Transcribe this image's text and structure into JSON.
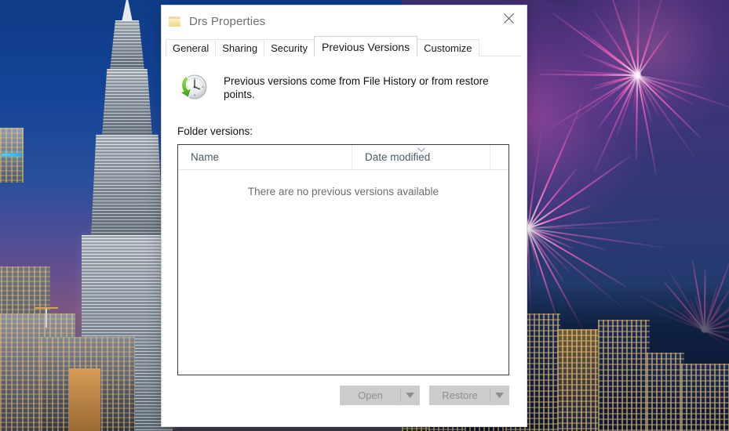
{
  "desktop": {
    "wallpaper_left": "petronas-towers-at-dusk",
    "wallpaper_right": "fireworks-over-city-skyline",
    "sky_color_left": "#154497",
    "sky_color_right": "#2b3a72",
    "firework_color": "#ff5fc0"
  },
  "dialog": {
    "title": "Drs Properties",
    "title_icon": "folder-icon",
    "close_label": "Close",
    "tabs": [
      {
        "label": "General",
        "active": false
      },
      {
        "label": "Sharing",
        "active": false
      },
      {
        "label": "Security",
        "active": false
      },
      {
        "label": "Previous Versions",
        "active": true
      },
      {
        "label": "Customize",
        "active": false
      }
    ],
    "info": {
      "icon": "restore-clock-icon",
      "text": "Previous versions come from File History or from restore points."
    },
    "list": {
      "label": "Folder versions:",
      "columns": [
        {
          "header": "Name",
          "sorted": false
        },
        {
          "header": "Date modified",
          "sorted": true
        }
      ],
      "sort_direction": "descending",
      "empty_message": "There are no previous versions available",
      "rows": []
    },
    "buttons": [
      {
        "label": "Open",
        "enabled": false,
        "has_dropdown": true
      },
      {
        "label": "Restore",
        "enabled": false,
        "has_dropdown": true
      }
    ]
  }
}
